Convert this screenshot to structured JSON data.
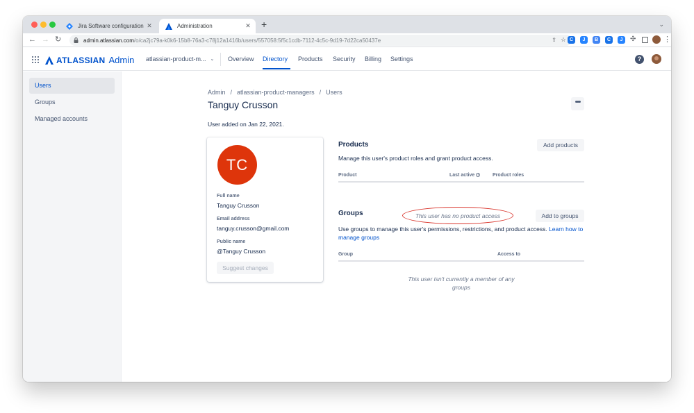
{
  "browser": {
    "tabs": [
      {
        "title": "Jira Software configuration - Ji",
        "active": false
      },
      {
        "title": "Administration",
        "active": true
      }
    ],
    "url_host": "admin.atlassian.com",
    "url_path": "/o/ca2jc79a-k0k6-15b8-76a3-c78j12a1416b/users/557058:5f5c1cdb-7112-4c5c-9d19-7d22ca50437e",
    "extensions": [
      {
        "icon": "cf-icon",
        "color": "#1a73e8",
        "glyph": "C"
      },
      {
        "icon": "jira-icon",
        "color": "#2684ff",
        "glyph": "J"
      },
      {
        "icon": "bookmark-app-icon",
        "color": "#4285f4",
        "glyph": "B"
      },
      {
        "icon": "refresh-app-icon",
        "color": "#1a73e8",
        "glyph": "C"
      },
      {
        "icon": "jira-ext-icon",
        "color": "#2684ff",
        "glyph": "J"
      }
    ]
  },
  "appnav": {
    "brand": "ATLASSIAN",
    "product": "Admin",
    "org": "atlassian-product-m...",
    "items": [
      "Overview",
      "Directory",
      "Products",
      "Security",
      "Billing",
      "Settings"
    ],
    "active": "Directory",
    "help": "?"
  },
  "sidebar": {
    "items": [
      "Users",
      "Groups",
      "Managed accounts"
    ],
    "active": "Users"
  },
  "breadcrumb": [
    "Admin",
    "atlassian-product-managers",
    "Users"
  ],
  "title": "Tanguy Crusson",
  "more": "•••",
  "added_text": "User added on Jan 22, 2021.",
  "profile": {
    "initials": "TC",
    "avatar_color": "#de350b",
    "fields": [
      {
        "label": "Full name",
        "value": "Tanguy Crusson"
      },
      {
        "label": "Email address",
        "value": "tanguy.crusson@gmail.com"
      },
      {
        "label": "Public name",
        "value": "@Tanguy Crusson"
      }
    ],
    "suggest_label": "Suggest changes"
  },
  "products": {
    "title": "Products",
    "add_button": "Add products",
    "description": "Manage this user's product roles and grant product access.",
    "columns": [
      "Product",
      "Last active",
      "Product roles"
    ],
    "empty": "This user has no product access"
  },
  "groups": {
    "title": "Groups",
    "add_button": "Add to groups",
    "description": "Use groups to manage this user's permissions, restrictions, and product access.",
    "link": "Learn how to manage groups",
    "columns": [
      "Group",
      "Access to"
    ],
    "empty": "This user isn't currently a member of any groups"
  },
  "colors": {
    "accent": "#0052cc",
    "callout": "#d9342b",
    "text": "#172b4d"
  }
}
